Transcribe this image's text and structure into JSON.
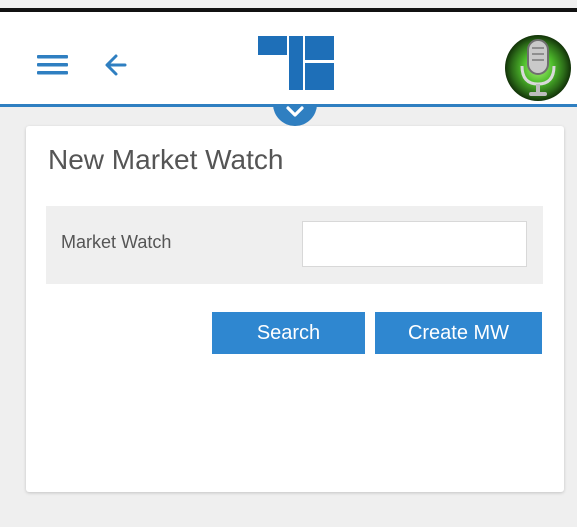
{
  "header": {
    "menu_icon": "hamburger-menu-icon",
    "back_icon": "arrow-left-icon",
    "logo_icon": "brand-logo-icon",
    "avatar_icon": "microphone-avatar-icon",
    "collapse_icon": "chevron-down-icon"
  },
  "card": {
    "title": "New Market Watch",
    "field": {
      "label": "Market Watch",
      "value": "",
      "placeholder": ""
    },
    "buttons": {
      "search_label": "Search",
      "create_label": "Create MW"
    }
  },
  "colors": {
    "accent": "#2f87d0",
    "header_line": "#2f7fc1",
    "logo_blue": "#1e6fb8",
    "background": "#efefef"
  }
}
